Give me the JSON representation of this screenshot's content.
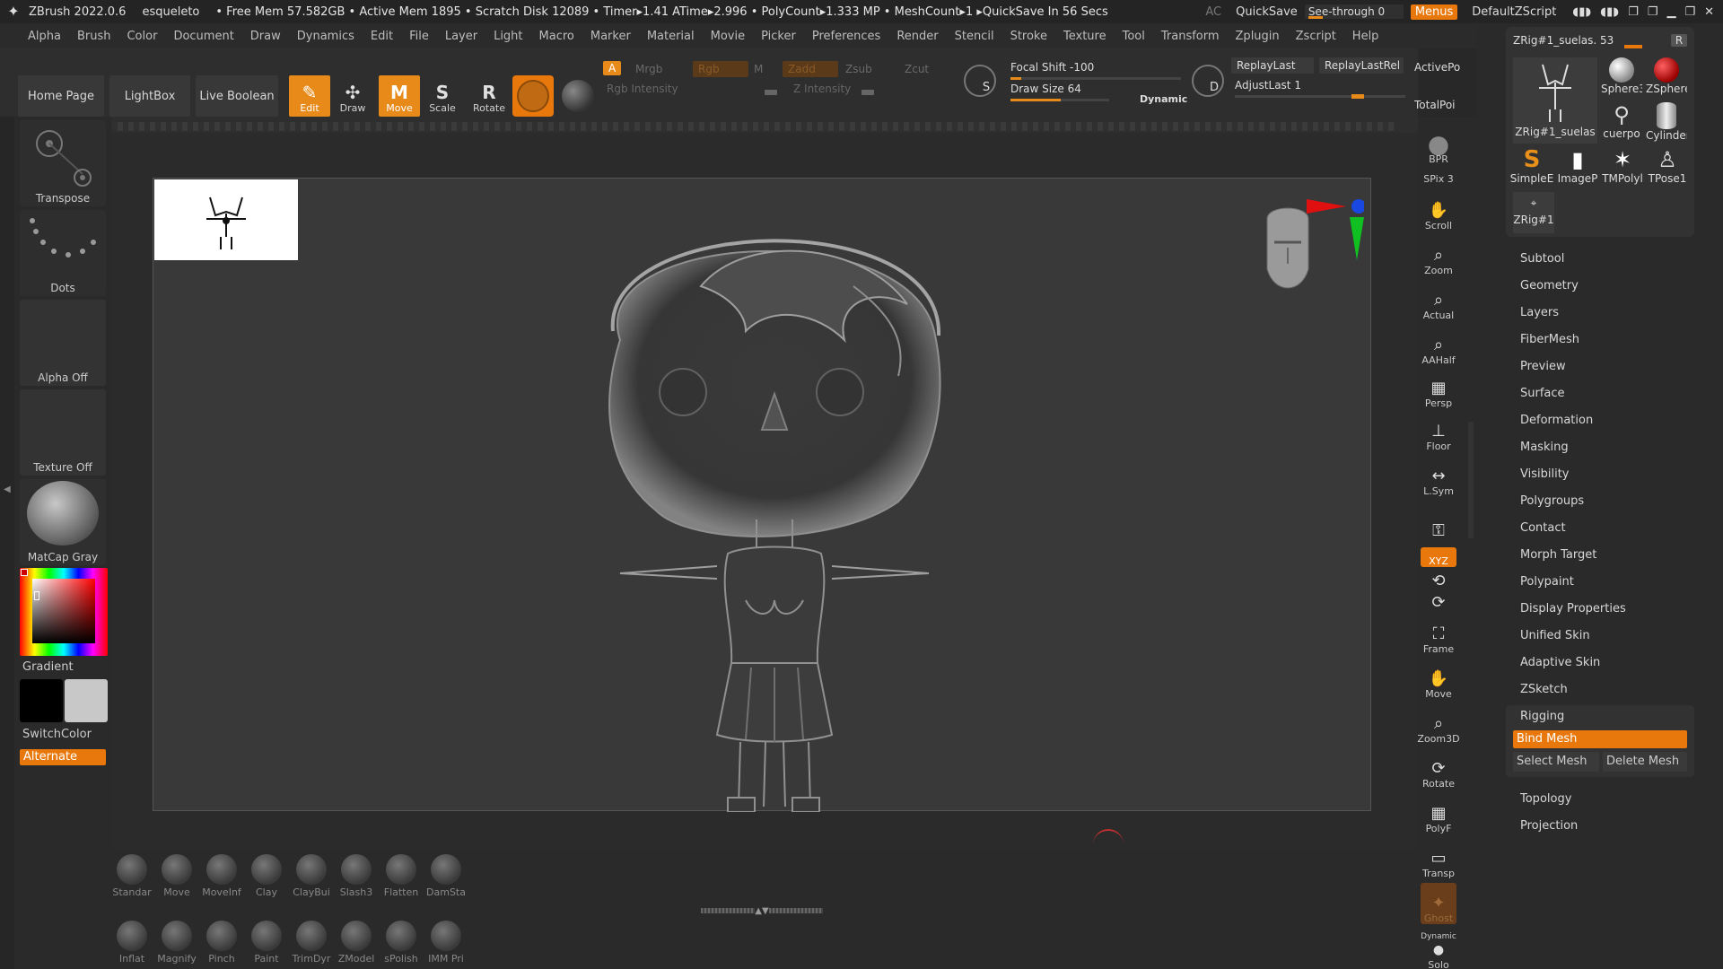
{
  "titlebar": {
    "app": "ZBrush 2022.0.6",
    "project": "esqueleto",
    "stats": "• Free Mem 57.582GB • Active Mem 1895 • Scratch Disk 12089 • Timer▸1.41 ATime▸2.996 • PolyCount▸1.333 MP • MeshCount▸1 ▸QuickSave In 56 Secs",
    "ac": "AC",
    "quicksave": "QuickSave",
    "seethrough": "See-through  0",
    "menus": "Menus",
    "script": "DefaultZScript"
  },
  "menu": [
    "Alpha",
    "Brush",
    "Color",
    "Document",
    "Draw",
    "Dynamics",
    "Edit",
    "File",
    "Layer",
    "Light",
    "Macro",
    "Marker",
    "Material",
    "Movie",
    "Picker",
    "Preferences",
    "Render",
    "Stencil",
    "Stroke",
    "Texture",
    "Tool",
    "Transform",
    "Zplugin",
    "Zscript",
    "Help"
  ],
  "shelf": {
    "home": "Home Page",
    "lightbox": "LightBox",
    "liveboolean": "Live Boolean",
    "tools": [
      {
        "label": "Edit",
        "icon": "✎"
      },
      {
        "label": "Draw",
        "icon": "✣"
      },
      {
        "label": "Move",
        "icon": "M"
      },
      {
        "label": "Scale",
        "icon": "S"
      },
      {
        "label": "Rotate",
        "icon": "R"
      }
    ],
    "channels": {
      "a": "A",
      "mrgb": "Mrgb",
      "rgb": "Rgb",
      "m": "M",
      "zadd": "Zadd",
      "zsub": "Zsub",
      "zcut": "Zcut"
    },
    "rgb_intensity": "Rgb Intensity",
    "z_intensity": "Z Intensity",
    "focal_shift": "Focal Shift -100",
    "draw_size": "Draw Size 64",
    "dynamic": "Dynamic",
    "s_label": "S",
    "d_label": "D",
    "replay_last": "ReplayLast",
    "replay_last_rel": "ReplayLastRel",
    "adjust_last": "AdjustLast  1",
    "active_po": "ActivePo",
    "total_poi": "TotalPoi"
  },
  "lefttray": {
    "transpose": "Transpose",
    "dots": "Dots",
    "alpha": "Alpha Off",
    "texture": "Texture Off",
    "matcap": "MatCap Gray",
    "gradient": "Gradient",
    "switchcolor": "SwitchColor",
    "alternate": "Alternate"
  },
  "brushes_row1": [
    "Standar",
    "Move",
    "MoveInf",
    "Clay",
    "ClayBui",
    "Slash3",
    "Flatten",
    "DamSta"
  ],
  "brushes_row2": [
    "Inflat",
    "Magnify",
    "Pinch",
    "Paint",
    "TrimDyr",
    "ZModel",
    "sPolish",
    "IMM Pri"
  ],
  "rightcol": [
    {
      "label": "BPR",
      "icon": "●"
    },
    {
      "label": "SPix 3",
      "icon": ""
    },
    {
      "label": "Scroll",
      "icon": "✋"
    },
    {
      "label": "Zoom",
      "icon": "⌕"
    },
    {
      "label": "Actual",
      "icon": "⌕"
    },
    {
      "label": "AAHalf",
      "icon": "⌕"
    },
    {
      "label": "Persp",
      "icon": "▦"
    },
    {
      "label": "Floor",
      "icon": "⊥"
    },
    {
      "label": "L.Sym",
      "icon": "↔"
    },
    {
      "label": "",
      "icon": "⚿"
    },
    {
      "label": "XYZ",
      "icon": ""
    },
    {
      "label": "Frame",
      "icon": "⛶"
    },
    {
      "label": "Move",
      "icon": "✋"
    },
    {
      "label": "Zoom3D",
      "icon": "⌕"
    },
    {
      "label": "Rotate",
      "icon": "⟳"
    },
    {
      "label": "PolyF",
      "icon": "▦"
    },
    {
      "label": "Transp",
      "icon": "▭"
    },
    {
      "label": "Ghost",
      "icon": "✦"
    },
    {
      "label": "Solo",
      "icon": "●"
    },
    {
      "label": "Dynamic",
      "icon": ""
    }
  ],
  "toolpanel": {
    "active": "ZRig#1_suelas. 53",
    "r": "R",
    "slots": [
      "ZRig#1_suelas",
      "Sphere3",
      "ZSphere",
      "cuerpo",
      "Cylinder",
      "SimpleE",
      "ImageP",
      "TMPolyl",
      "TPose1",
      "ZRig#1"
    ]
  },
  "subpalettes": [
    "Subtool",
    "Geometry",
    "Layers",
    "FiberMesh",
    "Preview",
    "Surface",
    "Deformation",
    "Masking",
    "Visibility",
    "Polygroups",
    "Contact",
    "Morph Target",
    "Polypaint",
    "Display Properties",
    "Unified Skin",
    "Adaptive Skin",
    "ZSketch",
    "Rigging",
    "Topology",
    "Projection"
  ],
  "rigging": {
    "bind": "Bind Mesh",
    "select": "Select Mesh",
    "delete": "Delete Mesh"
  },
  "colors": {
    "accent": "#e8780c",
    "panel": "#2a2a2a",
    "canvas": "#393939"
  }
}
